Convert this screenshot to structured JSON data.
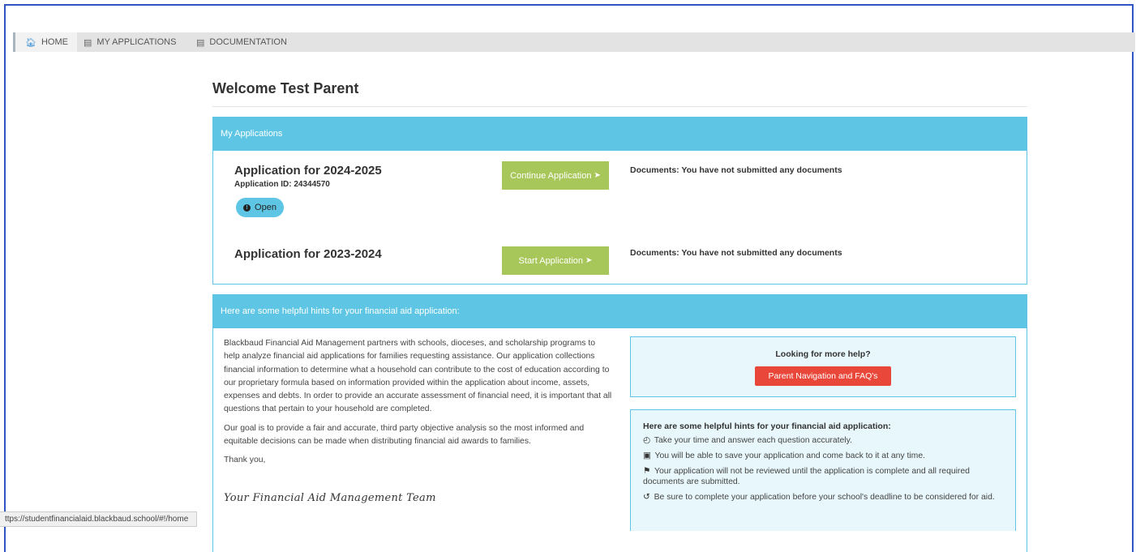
{
  "nav": {
    "home": "HOME",
    "home_icon": "home-icon",
    "applications": "MY APPLICATIONS",
    "applications_icon": "list-icon",
    "documentation": "DOCUMENTATION",
    "documentation_icon": "document-icon"
  },
  "page": {
    "title": "Welcome Test Parent"
  },
  "my_applications": {
    "header": "My Applications",
    "items": [
      {
        "title": "Application for 2024-2025",
        "id_label": "Application ID: 24344570",
        "status": "Open",
        "button_label": "Continue Application",
        "documents": "Documents:  You have not submitted any documents"
      },
      {
        "title": "Application for 2023-2024",
        "button_label": "Start Application",
        "documents": "Documents:  You have not submitted any documents"
      }
    ]
  },
  "hints_panel": {
    "header": "Here are some helpful hints for your financial aid application:",
    "paragraph1": "Blackbaud Financial Aid Management partners with schools, dioceses, and scholarship programs to help analyze financial aid applications for families requesting assistance. Our application collections financial information to determine what a household can contribute to the cost of education according to our proprietary formula based on information provided within the application about income, assets, expenses and debts. In order to provide an accurate assessment of financial need, it is important that all questions that pertain to your household are completed.",
    "paragraph2": "Our goal is to provide a fair and accurate, third party objective analysis so the most informed and equitable decisions can be made when distributing financial aid awards to families.",
    "thanks": "Thank you,",
    "signature": "Your Financial Aid Management Team",
    "help_title": "Looking for more help?",
    "help_button": "Parent Navigation and FAQ's",
    "hints_title": "Here are some helpful hints for your financial aid application:",
    "hints": [
      "Take your time and answer each question accurately.",
      "You will be able to save your application and come back to it at any time.",
      "Your application will not be reviewed until the application is complete and all required documents are submitted.",
      "Be sure to complete your application before your school's deadline to be considered for aid."
    ]
  },
  "status_bar": {
    "url": "ttps://studentfinancialaid.blackbaud.school/#!/home"
  },
  "colors": {
    "accent": "#5ec6e4",
    "button_green": "#a8c75a",
    "button_red": "#e8473a",
    "nav_bg": "#e3e3e3"
  }
}
